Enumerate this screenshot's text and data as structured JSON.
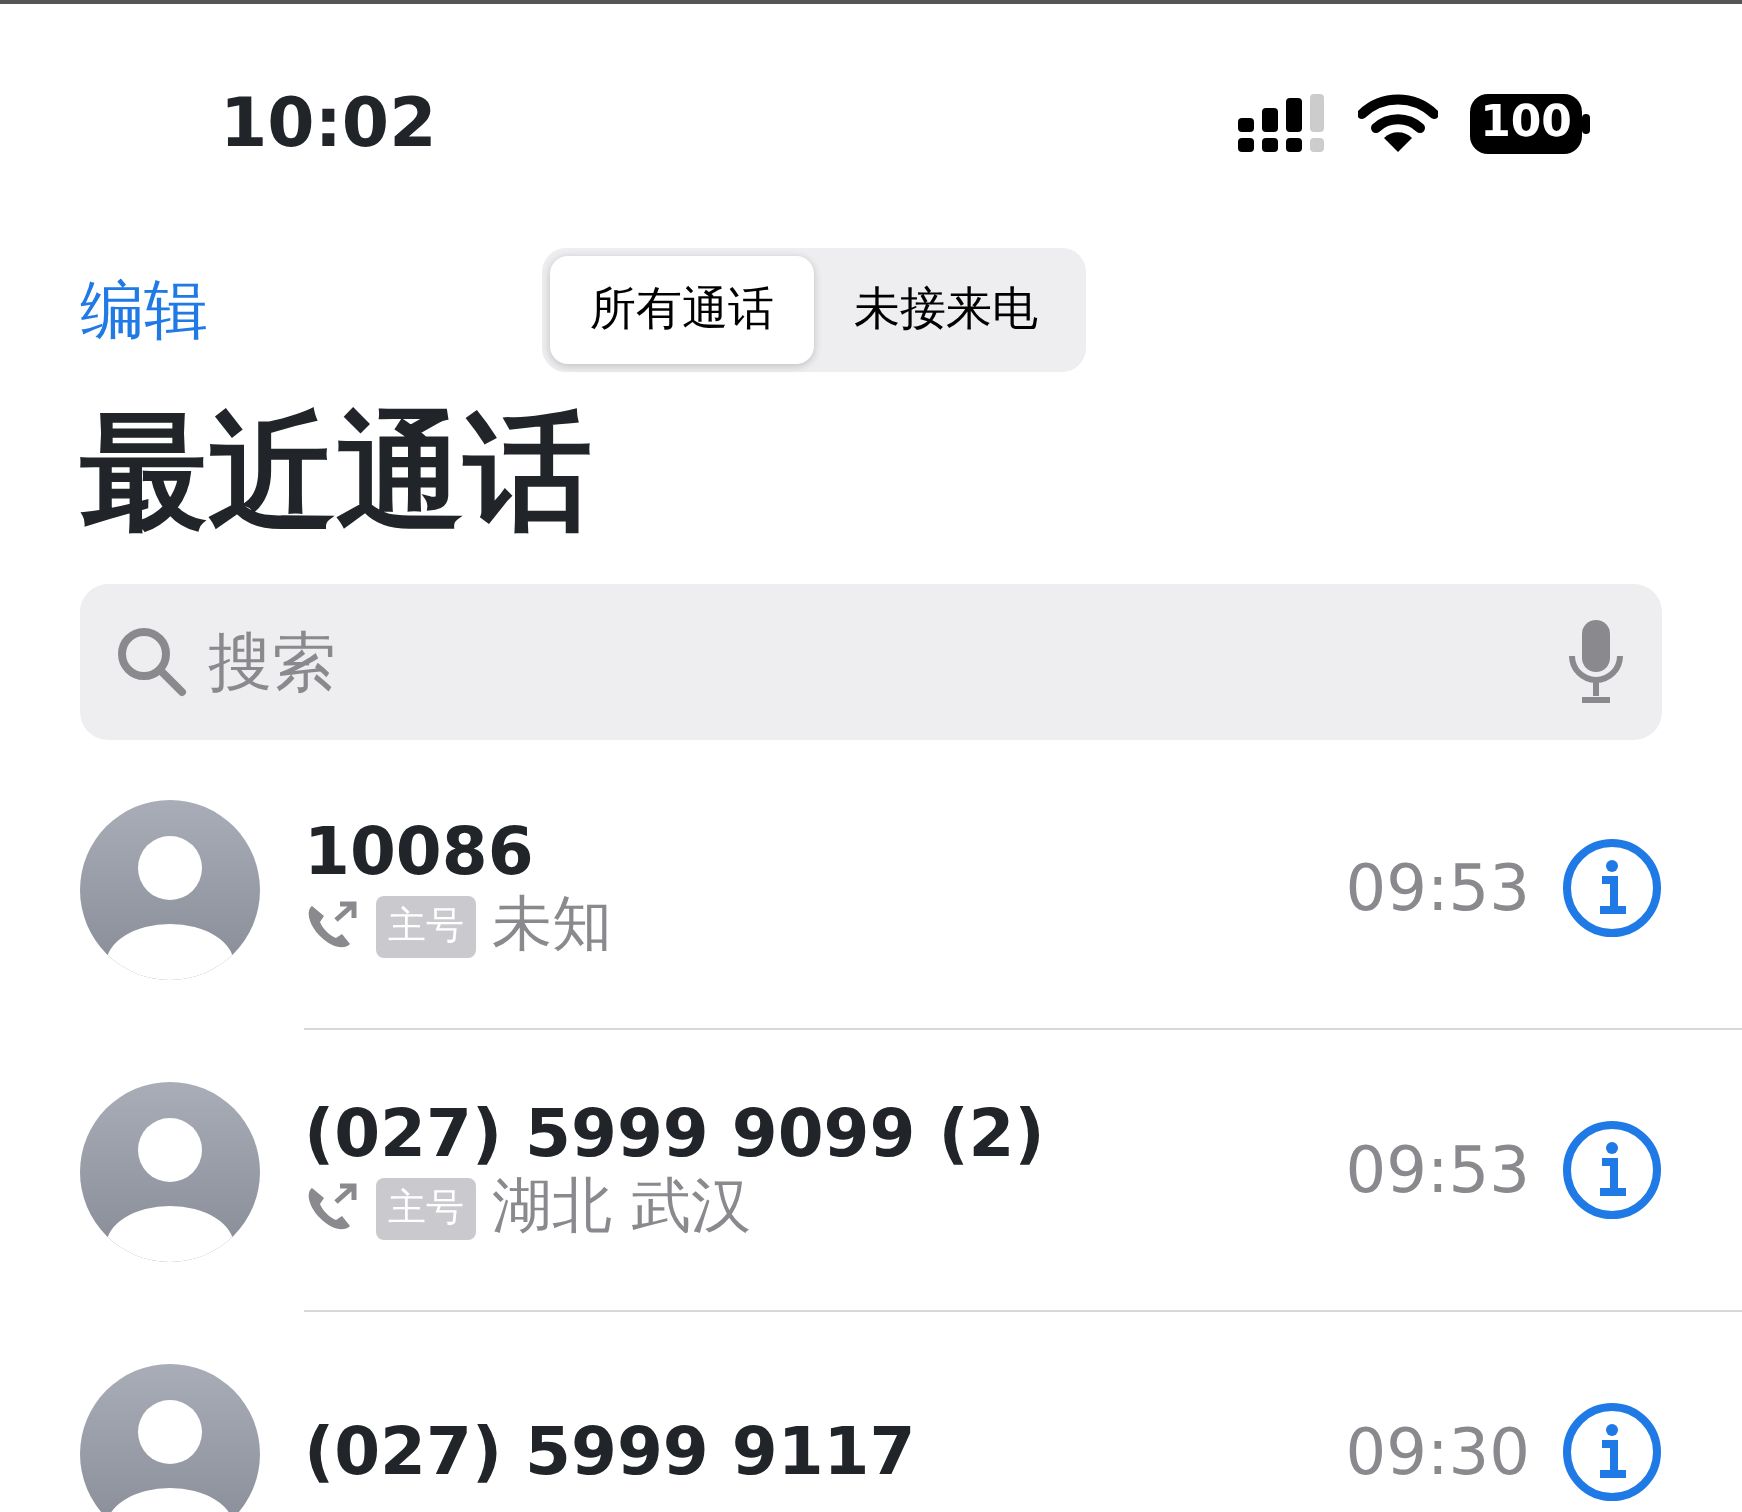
{
  "status_bar": {
    "time": "10:02",
    "battery": "100"
  },
  "header": {
    "edit": "编辑",
    "segments": [
      {
        "label": "所有通话",
        "selected": true
      },
      {
        "label": "未接来电",
        "selected": false
      }
    ]
  },
  "title": "最近通话",
  "search": {
    "placeholder": "搜索"
  },
  "calls": [
    {
      "name": "10086",
      "tag": "主号",
      "location": "未知",
      "time": "09:53",
      "outgoing": true
    },
    {
      "name": "(027) 5999 9099 (2)",
      "tag": "主号",
      "location": "湖北 武汉",
      "time": "09:53",
      "outgoing": true
    },
    {
      "name": "(027) 5999 9117",
      "time": "09:30",
      "outgoing": false
    }
  ]
}
